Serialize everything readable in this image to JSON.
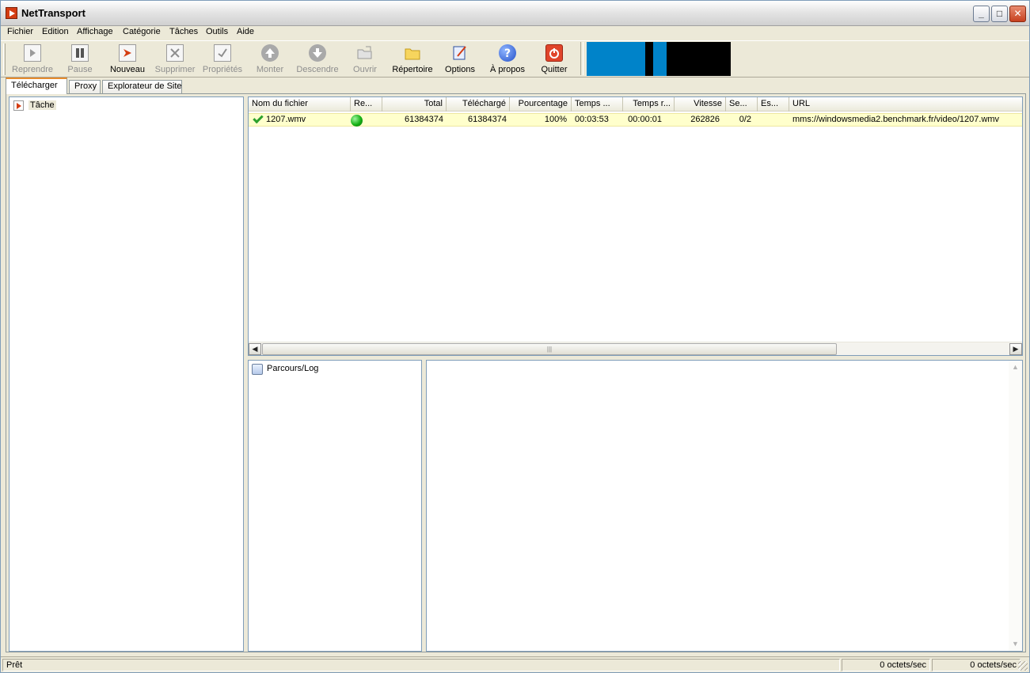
{
  "window": {
    "title": "NetTransport"
  },
  "menu": [
    "Fichier",
    "Edition",
    "Affichage",
    "Catégorie",
    "Tâches",
    "Outils",
    "Aide"
  ],
  "toolbar": {
    "reprendre": "Reprendre",
    "pause": "Pause",
    "nouveau": "Nouveau",
    "supprimer": "Supprimer",
    "proprietes": "Propriétés",
    "monter": "Monter",
    "descendre": "Descendre",
    "ouvrir": "Ouvrir",
    "repertoire": "Répertoire",
    "options": "Options",
    "apropos": "À propos",
    "quitter": "Quitter"
  },
  "tabs": [
    "Télécharger",
    "Proxy",
    "Explorateur de Site"
  ],
  "tree": {
    "root": "Tâche"
  },
  "list": {
    "columns": [
      "Nom du fichier",
      "Re...",
      "Total",
      "Téléchargé",
      "Pourcentage",
      "Temps ...",
      "Temps r...",
      "Vitesse",
      "Se...",
      "Es...",
      "URL"
    ],
    "rows": [
      {
        "name": "1207.wmv",
        "total": "61384374",
        "downloaded": "61384374",
        "percent": "100%",
        "time": "00:03:53",
        "remaining": "00:00:01",
        "speed": "262826",
        "segments": "0/2",
        "est": "",
        "url": "mms://windowsmedia2.benchmark.fr/video/1207.wmv"
      }
    ]
  },
  "log": {
    "root": "Parcours/Log"
  },
  "status": {
    "text": "Prêt",
    "speed1": "0 octets/sec",
    "speed2": "0 octets/sec"
  },
  "colors": {
    "graph_fill": "#0083c9",
    "row_highlight": "#ffffcc",
    "status_ok": "#15b115"
  }
}
